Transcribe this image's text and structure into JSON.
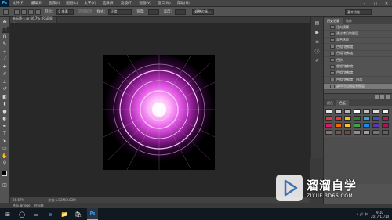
{
  "menubar": {
    "app_logo": "Ps",
    "items": [
      "文件(F)",
      "编辑(E)",
      "图像(I)",
      "图层(L)",
      "文字(Y)",
      "选择(S)",
      "滤镜(T)",
      "视图(V)",
      "窗口(W)",
      "帮助(H)"
    ],
    "window_controls": [
      "–",
      "□",
      "✕"
    ]
  },
  "optionsbar": {
    "feather_label": "羽化:",
    "feather_value": "0 像素",
    "antialias_label": "消除锯齿",
    "style_label": "样式:",
    "style_value": "正常",
    "width_label": "宽度:",
    "height_label": "高度:",
    "refine_edge": "调整边缘...",
    "workspace": "基本功能"
  },
  "document": {
    "tab_title": "未标题-1 @ 66.7% (RGB/8) ×",
    "zoom": "66.67%",
    "doc_info": "文档:1.83M/3.83M"
  },
  "bottom_panel": {
    "mini_bridge": "Mini Bridge",
    "timeline": "时间轴"
  },
  "history_panel": {
    "tabs": [
      "历史记录",
      "动作"
    ],
    "items": [
      "径向模糊",
      "通过拷贝的图层",
      "混合选项",
      "色相/饱和度",
      "色相/饱和度",
      "色阶",
      "色相/饱和度",
      "色相/饱和度",
      "色相/饱和度：图层",
      "盖印可见图层到图层"
    ],
    "selected_index": 9
  },
  "swatches_panel": {
    "tabs": [
      "颜色",
      "色板"
    ],
    "colors": [
      "#e6e6e6",
      "#d0d0d0",
      "#b9b9b9",
      "#ffffff",
      "#c0c0c0",
      "#dcdcdc",
      "#f0f0f0",
      "#e53935",
      "#e53935",
      "#f4c20d",
      "#2e7d32",
      "#2aa6d8",
      "#4a4ac8",
      "#c2185b",
      "#d81b60",
      "#ef6c00",
      "#fbc02d",
      "#43a047",
      "#1e88e5",
      "#5e35b1",
      "#ad1457",
      "#8d6e63",
      "#795548",
      "#6d4c41",
      "#a1887f",
      "#9e9e9e",
      "#757575",
      "#616161"
    ]
  },
  "watermark": {
    "title": "溜溜自学",
    "url": "ZIXUE.3D66.COM"
  },
  "taskbar": {
    "items": [
      "⊞",
      "◯",
      "▭",
      "e",
      "📁",
      "🛍",
      "Ps"
    ],
    "tray": "∧ 🔊 中",
    "time": "9:10",
    "date": "2017/11/14"
  },
  "colors": {
    "accent_purple": "#e65ae8",
    "art_bg": "#000000",
    "ps_blue": "#31a8ff"
  }
}
